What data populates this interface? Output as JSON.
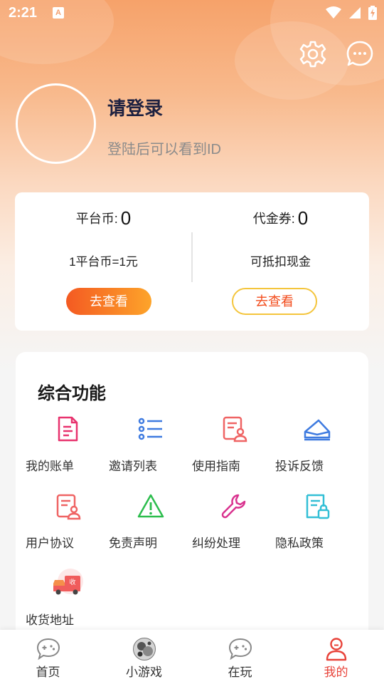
{
  "status_bar": {
    "time": "2:21",
    "notification_glyph": "A",
    "icons": [
      "wifi-icon",
      "signal-icon",
      "battery-charging-icon"
    ]
  },
  "top_actions": {
    "settings_icon": "gear-icon",
    "message_icon": "chat-bubble-icon"
  },
  "profile": {
    "title": "请登录",
    "subtitle": "登陆后可以看到ID"
  },
  "wallet": {
    "platform": {
      "label": "平台币:",
      "value": "0",
      "description": "1平台币=1元",
      "button": "去查看"
    },
    "voucher": {
      "label": "代金券:",
      "value": "0",
      "description": "可抵扣现金",
      "button": "去查看"
    }
  },
  "functions": {
    "title": "综合功能",
    "items": [
      {
        "label": "我的账单",
        "icon": "bill-icon"
      },
      {
        "label": "邀请列表",
        "icon": "list-icon"
      },
      {
        "label": "使用指南",
        "icon": "guide-icon"
      },
      {
        "label": "投诉反馈",
        "icon": "envelope-icon"
      },
      {
        "label": "用户协议",
        "icon": "agreement-icon"
      },
      {
        "label": "免责声明",
        "icon": "warning-icon"
      },
      {
        "label": "纠纷处理",
        "icon": "wrench-icon"
      },
      {
        "label": "隐私政策",
        "icon": "privacy-lock-icon"
      },
      {
        "label": "收货地址",
        "icon": "delivery-truck-icon",
        "badge": "收"
      }
    ]
  },
  "tabs": [
    {
      "label": "首页",
      "icon": "gamepad-icon",
      "active": false
    },
    {
      "label": "小游戏",
      "icon": "mini-game-avatar-icon",
      "active": false
    },
    {
      "label": "在玩",
      "icon": "gamepad-icon",
      "active": false
    },
    {
      "label": "我的",
      "icon": "user-icon",
      "active": true
    }
  ],
  "colors": {
    "accent": "#e8433a",
    "button_gradient_start": "#f45a22",
    "button_gradient_end": "#fda42a",
    "outline_button_border": "#f4c53c"
  }
}
